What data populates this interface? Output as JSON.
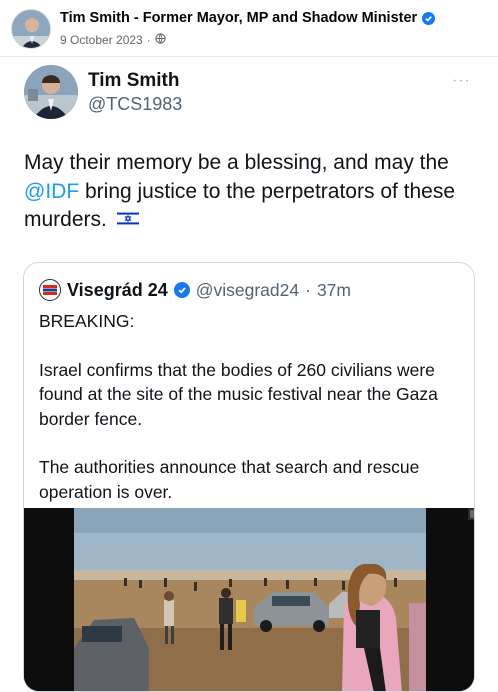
{
  "facebook_post": {
    "author": "Tim Smith - Former Mayor, MP and Shadow Minister",
    "date": "9 October 2023",
    "separator": "·",
    "audience_icon": "globe-icon"
  },
  "tweet": {
    "name": "Tim Smith",
    "handle": "@TCS1983",
    "more_label": "···",
    "text_before": "May their memory be a blessing, and may the ",
    "mention": "@IDF",
    "text_after": " bring justice to the perpetrators of these murders.",
    "flag_icon": "israel-flag-icon",
    "mention_color": "#1d9bf0"
  },
  "quoted_tweet": {
    "name": "Visegrád 24",
    "handle": "@visegrad24",
    "separator": "·",
    "time": "37m",
    "paragraphs": [
      "BREAKING:",
      "Israel confirms that the bodies of 260 civilians were found at the site of the music festival near the Gaza border fence.",
      "The authorities announce that search and rescue operation is over."
    ],
    "media": "video-still-people-fleeing-icon"
  }
}
